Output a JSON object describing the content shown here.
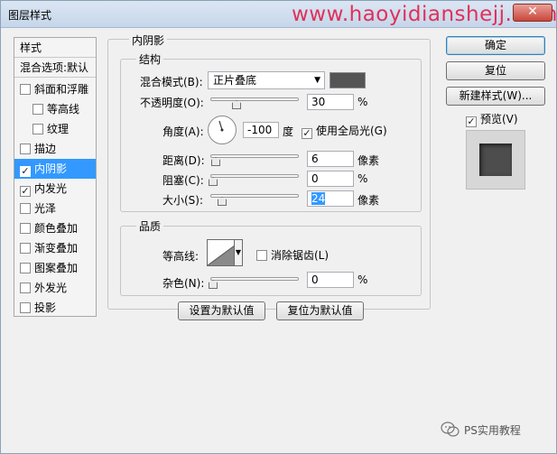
{
  "window": {
    "title": "图层样式",
    "watermark": "www.haoyidianshejj.com"
  },
  "style_list": {
    "header": "样式",
    "blend_options": "混合选项:默认",
    "items": [
      {
        "label": "斜面和浮雕",
        "checked": false
      },
      {
        "label": "等高线",
        "checked": false,
        "indent": true
      },
      {
        "label": "纹理",
        "checked": false,
        "indent": true
      },
      {
        "label": "描边",
        "checked": false
      },
      {
        "label": "内阴影",
        "checked": true,
        "selected": true
      },
      {
        "label": "内发光",
        "checked": true
      },
      {
        "label": "光泽",
        "checked": false
      },
      {
        "label": "颜色叠加",
        "checked": false
      },
      {
        "label": "渐变叠加",
        "checked": false
      },
      {
        "label": "图案叠加",
        "checked": false
      },
      {
        "label": "外发光",
        "checked": false
      },
      {
        "label": "投影",
        "checked": false
      }
    ]
  },
  "buttons": {
    "ok": "确定",
    "reset": "复位",
    "new_style": "新建样式(W)...",
    "preview": "预览(V)",
    "set_default": "设置为默认值",
    "reset_default": "复位为默认值"
  },
  "panel": {
    "title": "内阴影",
    "structure": {
      "label": "结构",
      "blend_mode_label": "混合模式(B):",
      "blend_mode_value": "正片叠底",
      "blend_color": "#555555",
      "opacity_label": "不透明度(O):",
      "opacity_value": "30",
      "opacity_unit": "%",
      "angle_label": "角度(A):",
      "angle_value": "-100",
      "angle_unit": "度",
      "global_light_label": "使用全局光(G)",
      "distance_label": "距离(D):",
      "distance_value": "6",
      "distance_unit": "像素",
      "choke_label": "阻塞(C):",
      "choke_value": "0",
      "choke_unit": "%",
      "size_label": "大小(S):",
      "size_value": "24",
      "size_unit": "像素"
    },
    "quality": {
      "label": "品质",
      "contour_label": "等高线:",
      "antialias_label": "消除锯齿(L)",
      "noise_label": "杂色(N):",
      "noise_value": "0",
      "noise_unit": "%"
    }
  },
  "footer": {
    "wechat_label": "PS实用教程"
  },
  "icons": {
    "checkmark": "✓",
    "dropdown": "▼",
    "close": "✕"
  }
}
